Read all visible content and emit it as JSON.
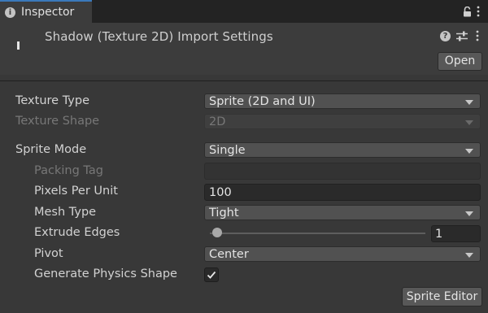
{
  "tab": {
    "label": "Inspector",
    "icon": "info-icon"
  },
  "header": {
    "title": "Shadow (Texture 2D) Import Settings",
    "open_label": "Open"
  },
  "fields": {
    "texture_type": {
      "label": "Texture Type",
      "value": "Sprite (2D and UI)"
    },
    "texture_shape": {
      "label": "Texture Shape",
      "value": "2D"
    },
    "sprite_mode": {
      "label": "Sprite Mode",
      "value": "Single"
    },
    "packing_tag": {
      "label": "Packing Tag",
      "value": ""
    },
    "pixels_per_unit": {
      "label": "Pixels Per Unit",
      "value": "100"
    },
    "mesh_type": {
      "label": "Mesh Type",
      "value": "Tight"
    },
    "extrude_edges": {
      "label": "Extrude Edges",
      "value": "1"
    },
    "pivot": {
      "label": "Pivot",
      "value": "Center"
    },
    "generate_physics_shape": {
      "label": "Generate Physics Shape",
      "checked": true
    }
  },
  "sprite_editor_label": "Sprite Editor",
  "colors": {
    "accent_tab": "#3a79bb",
    "panel_bg": "#383838",
    "field_bg": "#2a2a2a",
    "dropdown_bg": "#515151"
  }
}
